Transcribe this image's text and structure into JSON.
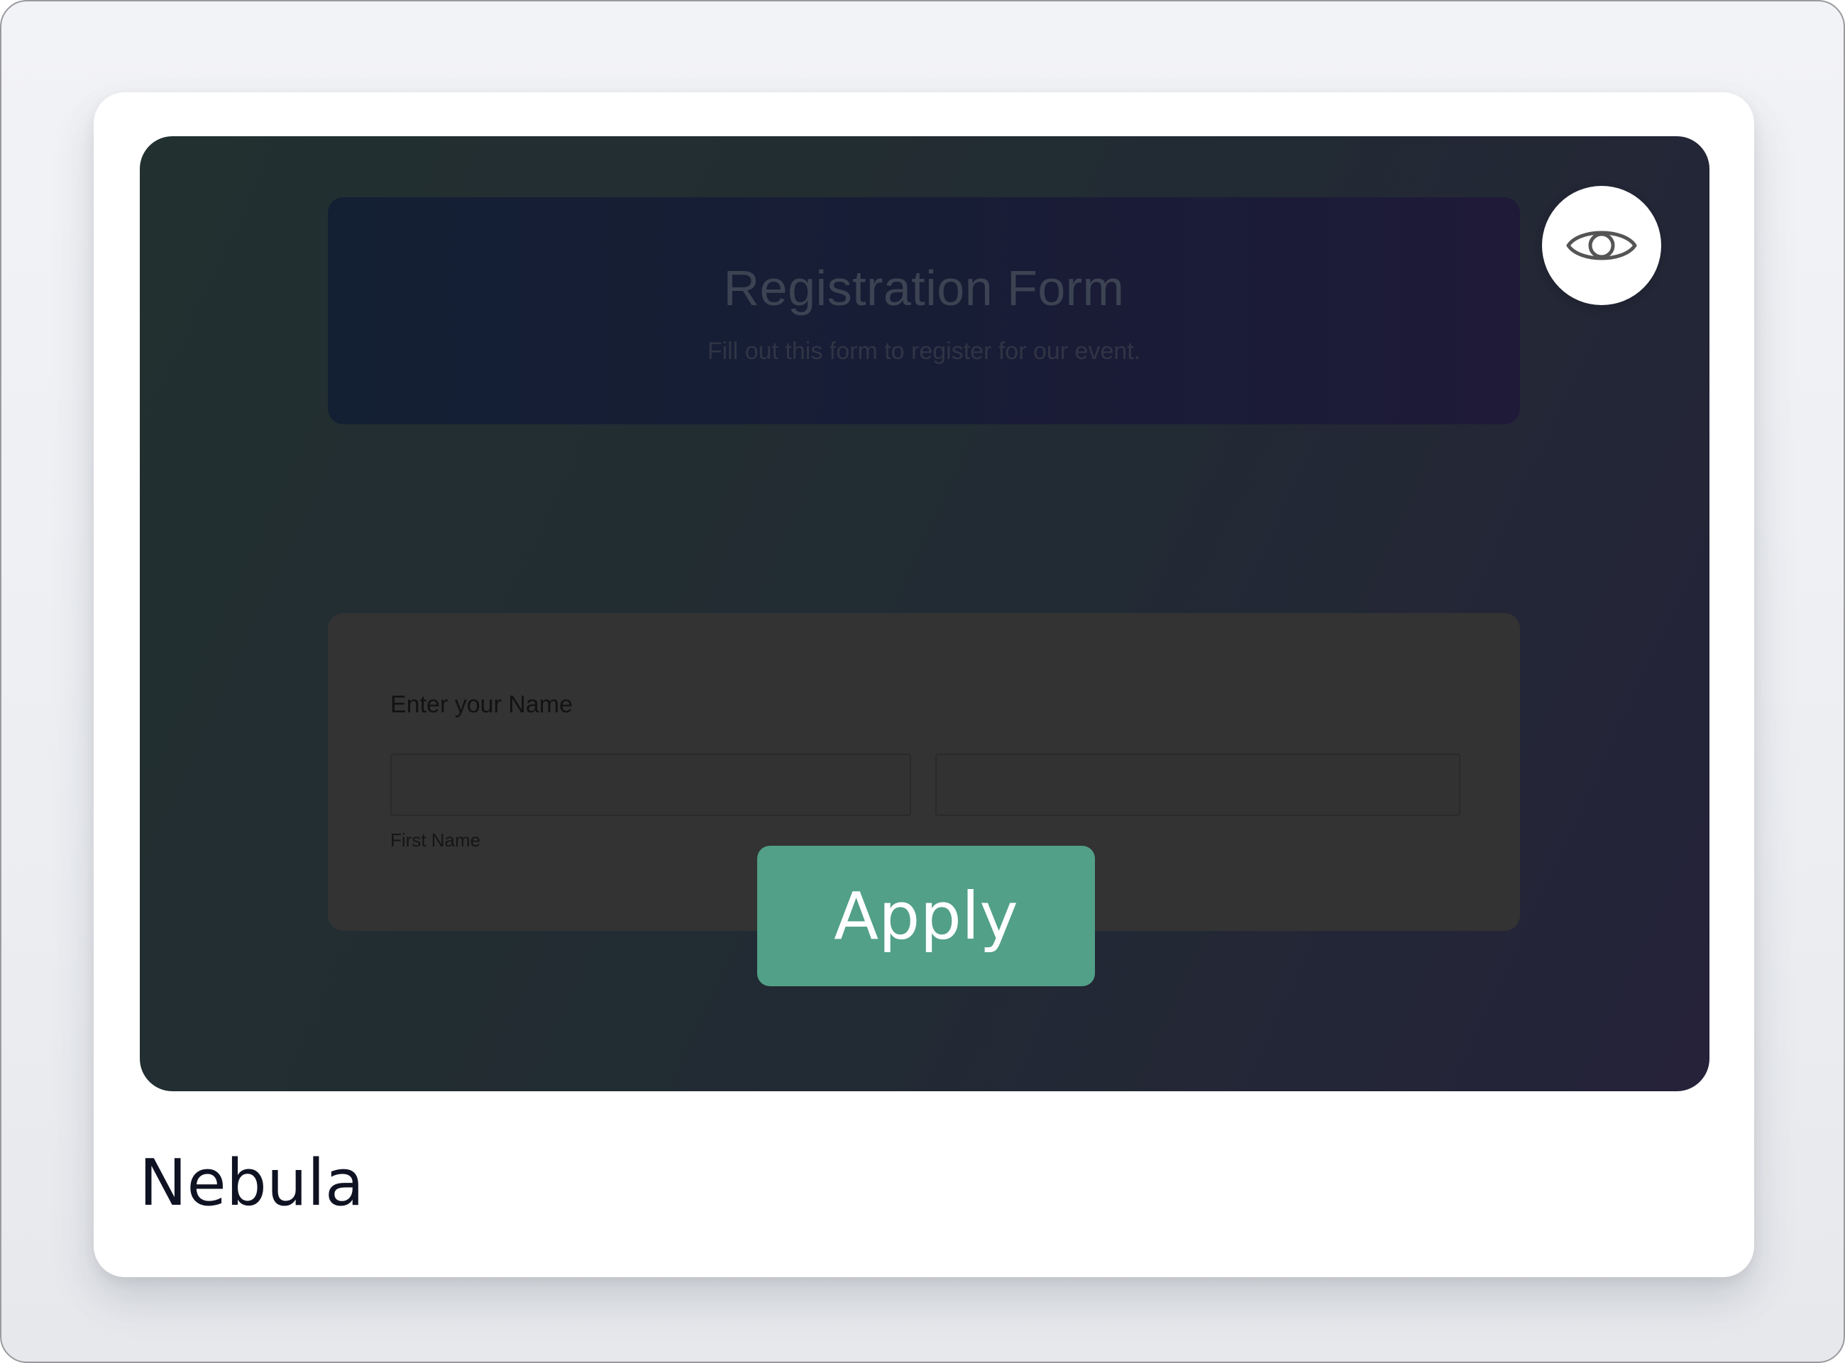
{
  "template_card": {
    "name": "Nebula",
    "apply_label": "Apply",
    "preview_button_icon": "eye-icon",
    "preview": {
      "form_title": "Registration Form",
      "form_subtitle": "Fill out this form to register for our event.",
      "name_field_label": "Enter your Name",
      "first_name_sublabel": "First Name",
      "first_name_value": "",
      "last_name_value": ""
    }
  },
  "colors": {
    "apply_button": "#52a088",
    "card_background": "#ffffff",
    "page_background": "#f2f3f6",
    "title_text": "#0f1222"
  }
}
